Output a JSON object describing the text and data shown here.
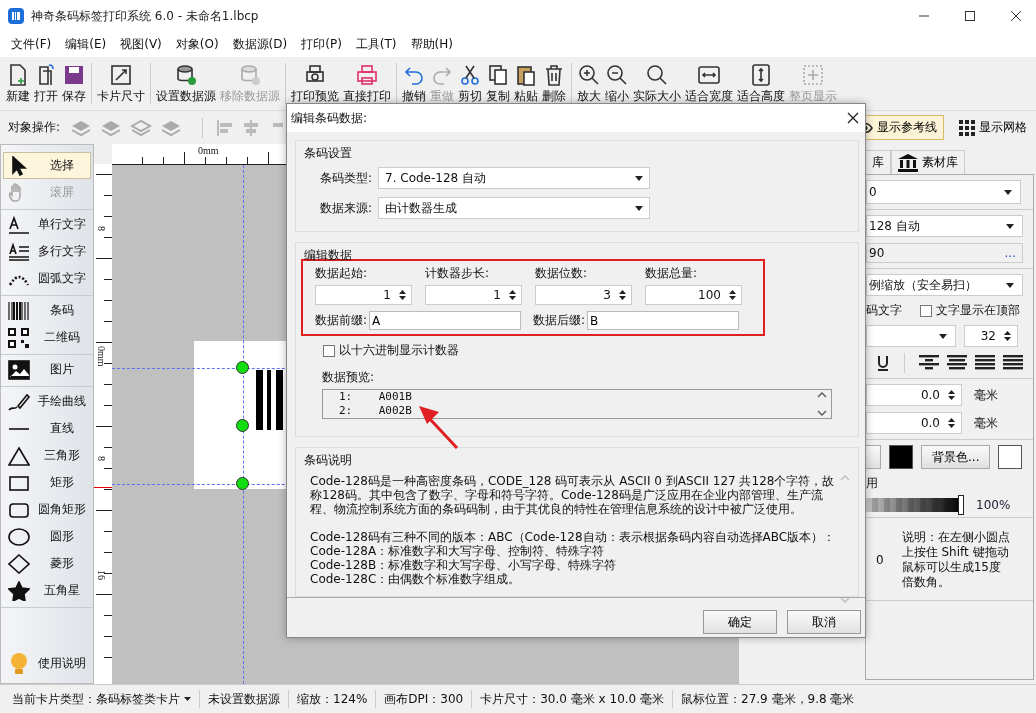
{
  "window": {
    "title": "神奇条码标签打印系统 6.0 - 未命名1.lbcp"
  },
  "menu": [
    "文件(F)",
    "编辑(E)",
    "视图(V)",
    "对象(O)",
    "数据源(D)",
    "打印(P)",
    "工具(T)",
    "帮助(H)"
  ],
  "toolbar": [
    [
      {
        "label": "新建",
        "disabled": false
      },
      {
        "label": "打开",
        "disabled": false
      },
      {
        "label": "保存",
        "disabled": false
      }
    ],
    [
      {
        "label": "卡片尺寸",
        "disabled": false
      }
    ],
    [
      {
        "label": "设置数据源",
        "disabled": false
      },
      {
        "label": "移除数据源",
        "disabled": true
      }
    ],
    [
      {
        "label": "打印预览",
        "disabled": false
      },
      {
        "label": "直接打印",
        "disabled": false
      }
    ],
    [
      {
        "label": "撤销",
        "disabled": false
      },
      {
        "label": "重做",
        "disabled": true
      },
      {
        "label": "剪切",
        "disabled": false
      },
      {
        "label": "复制",
        "disabled": false
      },
      {
        "label": "粘贴",
        "disabled": false
      },
      {
        "label": "删除",
        "disabled": false
      }
    ],
    [
      {
        "label": "放大",
        "disabled": false
      },
      {
        "label": "缩小",
        "disabled": false
      },
      {
        "label": "实际大小",
        "disabled": false
      },
      {
        "label": "适合宽度",
        "disabled": false
      },
      {
        "label": "适合高度",
        "disabled": false
      },
      {
        "label": "整页显示",
        "disabled": true
      }
    ]
  ],
  "object_bar": {
    "label": "对象操作:",
    "toggles": [
      {
        "label": "显示参考线",
        "on": true
      },
      {
        "label": "显示网格",
        "on": false
      }
    ]
  },
  "tools": [
    [
      {
        "label": "选择",
        "selected": true,
        "disabled": false
      },
      {
        "label": "滚屏",
        "selected": false,
        "disabled": true
      }
    ],
    [
      {
        "label": "单行文字",
        "selected": false,
        "disabled": false
      },
      {
        "label": "多行文字",
        "selected": false,
        "disabled": false
      },
      {
        "label": "圆弧文字",
        "selected": false,
        "disabled": false
      }
    ],
    [
      {
        "label": "条码",
        "selected": false,
        "disabled": false
      },
      {
        "label": "二维码",
        "selected": false,
        "disabled": false
      }
    ],
    [
      {
        "label": "图片",
        "selected": false,
        "disabled": false
      }
    ],
    [
      {
        "label": "手绘曲线",
        "selected": false,
        "disabled": false
      },
      {
        "label": "直线",
        "selected": false,
        "disabled": false
      },
      {
        "label": "三角形",
        "selected": false,
        "disabled": false
      },
      {
        "label": "矩形",
        "selected": false,
        "disabled": false
      },
      {
        "label": "圆角矩形",
        "selected": false,
        "disabled": false
      },
      {
        "label": "圆形",
        "selected": false,
        "disabled": false
      },
      {
        "label": "菱形",
        "selected": false,
        "disabled": false
      },
      {
        "label": "五角星",
        "selected": false,
        "disabled": false
      }
    ]
  ],
  "help_button": "使用说明",
  "ruler": {
    "top_labels": [
      "0mm"
    ],
    "left_labels": [
      "8",
      "0mm",
      "8",
      "16"
    ]
  },
  "right_panel": {
    "tabs": [
      {
        "label": "库",
        "selected": false
      },
      {
        "label": "素材库",
        "selected": false
      }
    ],
    "style_dropdown": "0",
    "type_dropdown": "128 自动",
    "data_field": "90",
    "data_button": "...",
    "scale_dropdown": "例缩放（安全易扫）",
    "text_label": "码文字",
    "top_checkbox": {
      "label": "文字显示在顶部",
      "checked": false
    },
    "font_size": "32",
    "offsets": [
      {
        "value": "0.0",
        "unit": "毫米"
      },
      {
        "value": "0.0",
        "unit": "毫米"
      }
    ],
    "foreground": {
      "color": "#000000"
    },
    "background_button": "背景色...",
    "background": {
      "color": "#ffffff"
    },
    "opacity_label": "用",
    "opacity": {
      "level": 1.0,
      "reading": "100%"
    },
    "rotation": "0",
    "note": "说明：在左侧小圆点上按住 Shift 键拖动鼠标可以生成15度倍数角。"
  },
  "dialog": {
    "title": "编辑条码数据:",
    "settings": {
      "legend": "条码设置",
      "fields": [
        {
          "label": "条码类型:",
          "value": "7.  Code-128 自动"
        },
        {
          "label": "数据来源:",
          "value": "由计数器生成"
        }
      ]
    },
    "edit": {
      "legend": "编辑数据",
      "spinners": [
        {
          "label": "数据起始:",
          "value": "1"
        },
        {
          "label": "计数器步长:",
          "value": "1"
        },
        {
          "label": "数据位数:",
          "value": "3"
        },
        {
          "label": "数据总量:",
          "value": "100"
        }
      ],
      "prefix": {
        "label": "数据前缀:",
        "value": "A"
      },
      "suffix": {
        "label": "数据后缀:",
        "value": "B"
      },
      "hex_checkbox": {
        "label": "以十六进制显示计数器",
        "checked": false
      },
      "preview_label": "数据预览:",
      "preview": [
        {
          "index": "1:",
          "value": "A001B"
        },
        {
          "index": "2:",
          "value": "A002B"
        }
      ]
    },
    "description": {
      "legend": "条码说明",
      "paragraphs": [
        [
          "Code-128码是一种高密度条码，CODE_128 码可表示从 ASCII 0 到ASCII 127 共128个字符，故称128码。其中包含了数字、字母和符号字符。Code-128码是广泛应用在企业内部管理、生产流程、物流控制系统方面的条码码制，由于其优良的特性在管理信息系统的设计中被广泛使用。"
        ],
        [
          "Code-128码有三种不同的版本：ABC（Code-128自动：表示根据条码内容自动选择ABC版本）：",
          "Code-128A：标准数字和大写字母、控制符、特殊字符",
          "Code-128B：标准数字和大写字母、小写字母、特殊字符",
          "Code-128C：由偶数个标准数字组成。"
        ]
      ]
    },
    "buttons": [
      "确定",
      "取消"
    ]
  },
  "status_bar": {
    "card_type": {
      "label": "当前卡片类型：",
      "value": "条码标签类卡片"
    },
    "items": [
      "未设置数据源",
      "缩放：124%",
      "画布DPI：300",
      "卡片尺寸：30.0 毫米 x 10.0 毫米",
      "鼠标位置：27.9 毫米，9.8 毫米"
    ]
  }
}
